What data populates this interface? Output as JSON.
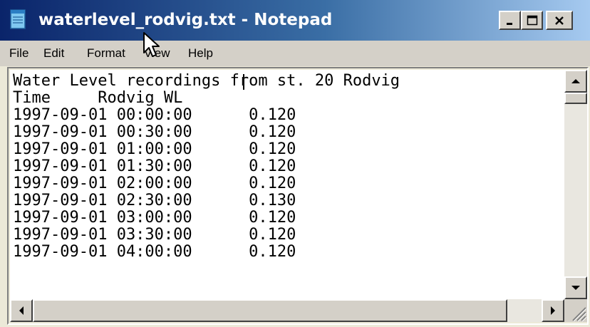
{
  "window": {
    "title": "waterlevel_rodvig.txt - Notepad",
    "icon": "notepad-icon",
    "controls": [
      "minimize-icon",
      "maximize-icon",
      "close-icon"
    ]
  },
  "menu": {
    "items": [
      "File",
      "Edit",
      "Format",
      "View",
      "Help"
    ]
  },
  "document": {
    "lines": [
      "Water Level recordings from st. 20 Rodvig",
      "Time     Rodvig WL",
      "1997-09-01 00:00:00      0.120",
      "1997-09-01 00:30:00      0.120",
      "1997-09-01 01:00:00      0.120",
      "1997-09-01 01:30:00      0.120",
      "1997-09-01 02:00:00      0.120",
      "1997-09-01 02:30:00      0.130",
      "1997-09-01 03:00:00      0.120",
      "1997-09-01 03:30:00      0.120",
      "1997-09-01 04:00:00      0.120"
    ]
  },
  "colors": {
    "titlebar_start": "#0a246a",
    "titlebar_end": "#a6caf0",
    "chrome": "#d4d0c8",
    "editor_bg": "#ffffff"
  }
}
